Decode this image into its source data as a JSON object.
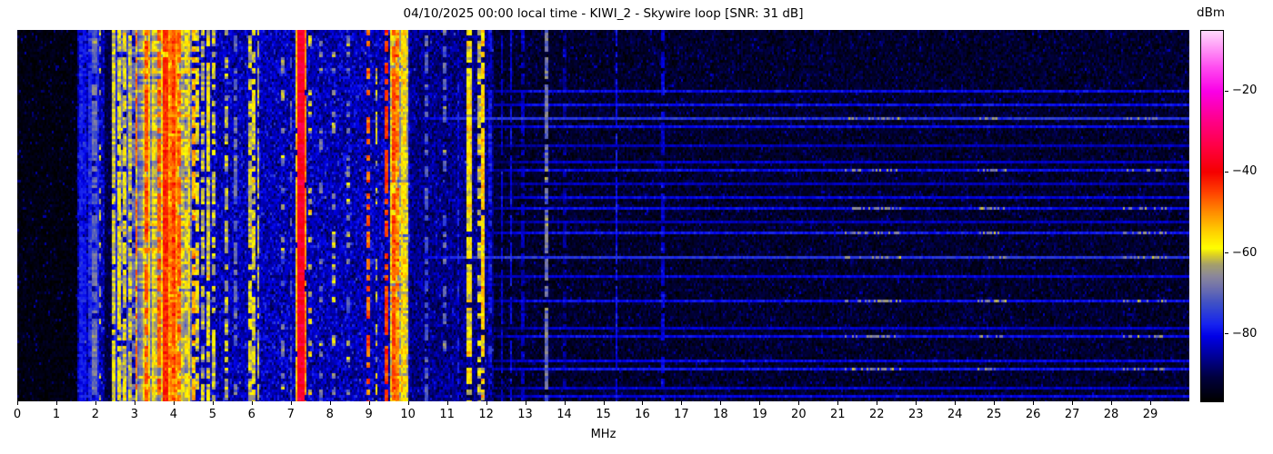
{
  "header": {
    "title": "04/10/2025 00:00 local time - KIWI_2 - Skywire loop [SNR: 31 dB]"
  },
  "chart_data": {
    "type": "heatmap",
    "subtype": "radio-spectrum-waterfall",
    "title": "04/10/2025 00:00 local time - KIWI_2 - Skywire loop [SNR: 31 dB]",
    "xlabel": "MHz",
    "x_range_mhz": [
      0,
      30
    ],
    "x_ticks": [
      "0",
      "1",
      "2",
      "3",
      "4",
      "5",
      "6",
      "7",
      "8",
      "9",
      "10",
      "11",
      "12",
      "13",
      "14",
      "15",
      "16",
      "17",
      "18",
      "19",
      "20",
      "21",
      "22",
      "23",
      "24",
      "25",
      "26",
      "27",
      "28",
      "29"
    ],
    "colorbar": {
      "label": "dBm",
      "tick_labels": [
        "−20",
        "−40",
        "−60",
        "−80"
      ],
      "tick_values": [
        -20,
        -40,
        -60,
        -80
      ],
      "range_dbm": [
        -97,
        -5
      ]
    },
    "colormap_stops": [
      [
        -97,
        "#000000"
      ],
      [
        -91,
        "#000040"
      ],
      [
        -86,
        "#000096"
      ],
      [
        -81,
        "#0000e6"
      ],
      [
        -78,
        "#1622f0"
      ],
      [
        -73,
        "#3c4ec8"
      ],
      [
        -69,
        "#6d6fae"
      ],
      [
        -66,
        "#8b879b"
      ],
      [
        -63,
        "#a6a06a"
      ],
      [
        -60.5,
        "#e0d520"
      ],
      [
        -59,
        "#ffff00"
      ],
      [
        -55,
        "#ffd200"
      ],
      [
        -50,
        "#ff8c00"
      ],
      [
        -45,
        "#ff4000"
      ],
      [
        -40,
        "#f50000"
      ],
      [
        -34,
        "#ff0040"
      ],
      [
        -27,
        "#ff008c"
      ],
      [
        -20,
        "#fa00e6"
      ],
      [
        -14,
        "#ff4cf0"
      ],
      [
        -8,
        "#ffaaf8"
      ],
      [
        -5,
        "#ffd8fc"
      ]
    ],
    "noise_regions": [
      {
        "f1": 0,
        "f2": 1.55,
        "base": -95.5,
        "sigma": 1.3,
        "speckle": 0.05,
        "spv": 7
      },
      {
        "f1": 2.24,
        "f2": 2.42,
        "base": -91,
        "sigma": 2.0,
        "speckle": 0.05,
        "spv": 6
      },
      {
        "f1": 1.55,
        "f2": 10.05,
        "base": -84,
        "sigma": 3.5,
        "speckle": 0.03,
        "spv": 6
      },
      {
        "f1": 10.05,
        "f2": 12.2,
        "base": -87,
        "sigma": 3.0,
        "speckle": 0.03,
        "spv": 6
      },
      {
        "f1": 12.2,
        "f2": 30,
        "base": -93,
        "sigma": 2.2,
        "speckle": 0.06,
        "spv": 5
      }
    ],
    "signal_bands": [
      {
        "f": 1.62,
        "w": 0.06,
        "v": -79,
        "j": 3,
        "duty": 0.95
      },
      {
        "f": 1.74,
        "w": 0.05,
        "v": -80,
        "j": 3,
        "duty": 0.9
      },
      {
        "f": 1.87,
        "w": 0.06,
        "v": -77,
        "j": 4,
        "duty": 0.95
      },
      {
        "f": 1.98,
        "w": 0.05,
        "v": -70,
        "j": 5,
        "duty": 0.8
      },
      {
        "f": 2.06,
        "w": 0.04,
        "v": -78,
        "j": 3,
        "duty": 0.9
      },
      {
        "f": 2.11,
        "w": 0.03,
        "v": -62,
        "j": 3,
        "duty": 0.25
      },
      {
        "f": 2.46,
        "w": 0.05,
        "v": -61,
        "j": 4,
        "duty": 0.9
      },
      {
        "f": 2.52,
        "w": 0.03,
        "v": -78,
        "j": 3,
        "duty": 1
      },
      {
        "f": 2.59,
        "w": 0.05,
        "v": -60,
        "j": 4,
        "duty": 0.9
      },
      {
        "f": 2.67,
        "w": 0.04,
        "v": -68,
        "j": 6,
        "duty": 0.8
      },
      {
        "f": 2.74,
        "w": 0.05,
        "v": -60,
        "j": 5,
        "duty": 0.85
      },
      {
        "f": 2.83,
        "w": 0.04,
        "v": -75,
        "j": 4,
        "duty": 0.9
      },
      {
        "f": 2.9,
        "w": 0.05,
        "v": -62,
        "j": 5,
        "duty": 0.85
      },
      {
        "f": 2.97,
        "w": 0.04,
        "v": -70,
        "j": 5,
        "duty": 0.7
      },
      {
        "f1": 3.05,
        "f2": 4.45,
        "v": -63,
        "j": 6
      },
      {
        "f1": 3.7,
        "f2": 4.12,
        "v": -55,
        "j": 5
      },
      {
        "f": 3.05,
        "w": 0.035,
        "v": -48,
        "j": 4,
        "duty": 0.7
      },
      {
        "f": 3.3,
        "w": 0.04,
        "v": -46,
        "j": 4,
        "duty": 0.8
      },
      {
        "f": 3.62,
        "w": 0.04,
        "v": -47,
        "j": 4,
        "duty": 0.75
      },
      {
        "f": 3.79,
        "w": 0.06,
        "v": -43,
        "j": 3,
        "duty": 0.95
      },
      {
        "f": 3.9,
        "w": 0.05,
        "v": -50,
        "j": 4,
        "duty": 0.8
      },
      {
        "f": 4.0,
        "w": 0.05,
        "v": -45,
        "j": 4,
        "duty": 0.85
      },
      {
        "f": 4.16,
        "w": 0.04,
        "v": -47,
        "j": 4,
        "duty": 0.8
      },
      {
        "f": 4.33,
        "w": 0.04,
        "v": -60,
        "j": 5,
        "duty": 0.8
      },
      {
        "f": 4.5,
        "w": 0.04,
        "v": -52,
        "j": 5,
        "duty": 0.6
      },
      {
        "f": 4.62,
        "w": 0.05,
        "v": -60,
        "j": 5,
        "duty": 0.8
      },
      {
        "f": 4.75,
        "w": 0.04,
        "v": -63,
        "j": 5,
        "duty": 0.7
      },
      {
        "f": 4.9,
        "w": 0.05,
        "v": -60,
        "j": 5,
        "duty": 0.8
      },
      {
        "f": 5.02,
        "w": 0.04,
        "v": -62,
        "j": 5,
        "duty": 0.7
      },
      {
        "f": 5.35,
        "w": 0.04,
        "v": -63,
        "j": 5,
        "duty": 0.6
      },
      {
        "f": 5.6,
        "w": 0.03,
        "v": -70,
        "j": 5,
        "duty": 0.5
      },
      {
        "f": 5.95,
        "w": 0.05,
        "v": -61,
        "j": 5,
        "duty": 0.8
      },
      {
        "f": 6.07,
        "w": 0.05,
        "v": -60,
        "j": 5,
        "duty": 0.85
      },
      {
        "f": 6.17,
        "w": 0.04,
        "v": -63,
        "j": 5,
        "duty": 0.7
      },
      {
        "f": 6.8,
        "w": 0.03,
        "v": -66,
        "j": 6,
        "duty": 0.35
      },
      {
        "f": 7.0,
        "w": 0.03,
        "v": -72,
        "j": 5,
        "duty": 0.4
      },
      {
        "f": 7.17,
        "w": 0.04,
        "v": -55,
        "j": 4,
        "duty": 0.9
      },
      {
        "f": 7.25,
        "w": 0.12,
        "v": -36,
        "j": 3,
        "duty": 1
      },
      {
        "f": 7.33,
        "w": 0.05,
        "v": -50,
        "j": 4,
        "duty": 0.9
      },
      {
        "f": 7.5,
        "w": 0.03,
        "v": -60,
        "j": 8,
        "duty": 0.2
      },
      {
        "f": 7.78,
        "w": 0.03,
        "v": -67,
        "j": 6,
        "duty": 0.3
      },
      {
        "f": 8.1,
        "w": 0.03,
        "v": -64,
        "j": 6,
        "duty": 0.3
      },
      {
        "f": 8.47,
        "w": 0.03,
        "v": -68,
        "j": 6,
        "duty": 0.3
      },
      {
        "f": 9.0,
        "w": 0.035,
        "v": -47,
        "j": 5,
        "duty": 0.45
      },
      {
        "f": 9.2,
        "w": 0.03,
        "v": -60,
        "j": 6,
        "duty": 0.4
      },
      {
        "f": 9.43,
        "w": 0.045,
        "v": -44,
        "j": 4,
        "duty": 0.65
      },
      {
        "f": 9.62,
        "w": 0.05,
        "v": -46,
        "j": 4,
        "duty": 0.9
      },
      {
        "f1": 9.55,
        "f2": 10.0,
        "v": -60,
        "j": 6
      },
      {
        "f": 9.75,
        "w": 0.05,
        "v": -50,
        "j": 5,
        "duty": 0.8
      },
      {
        "f": 9.9,
        "w": 0.04,
        "v": -58,
        "j": 5,
        "duty": 0.8
      },
      {
        "f": 10.47,
        "w": 0.03,
        "v": -72,
        "j": 4,
        "duty": 0.5
      },
      {
        "f": 10.93,
        "w": 0.03,
        "v": -70,
        "j": 5,
        "duty": 0.4
      },
      {
        "f": 11.28,
        "w": 0.03,
        "v": -80,
        "j": 4,
        "duty": 0.6
      },
      {
        "f": 11.56,
        "w": 0.07,
        "v": -58,
        "j": 5,
        "duty": 0.95
      },
      {
        "f": 11.82,
        "w": 0.03,
        "v": -62,
        "j": 6,
        "duty": 0.5
      },
      {
        "f": 11.93,
        "w": 0.045,
        "v": -55,
        "j": 5,
        "duty": 0.9
      },
      {
        "f": 12.1,
        "w": 0.03,
        "v": -80,
        "j": 4,
        "duty": 0.7
      },
      {
        "f": 12.4,
        "w": 0.03,
        "v": -83,
        "j": 3,
        "duty": 0.8
      },
      {
        "f": 12.63,
        "w": 0.03,
        "v": -81,
        "j": 3,
        "duty": 0.8
      },
      {
        "f": 12.95,
        "w": 0.03,
        "v": -84,
        "j": 3,
        "duty": 0.7
      },
      {
        "f": 13.55,
        "w": 0.035,
        "v": -69,
        "j": 5,
        "duty": 0.85
      },
      {
        "f": 14.0,
        "w": 0.025,
        "v": -86,
        "j": 3,
        "duty": 0.5
      },
      {
        "f": 15.33,
        "w": 0.03,
        "v": -80,
        "j": 3,
        "duty": 0.85
      },
      {
        "f": 16.53,
        "w": 0.03,
        "v": -82,
        "j": 3,
        "duty": 0.7
      }
    ],
    "time_streaks": [
      {
        "y": 0.164,
        "v": -80,
        "hot": false,
        "fmin": 12.2
      },
      {
        "y": 0.196,
        "v": -80,
        "hot": false,
        "fmin": 12.2
      },
      {
        "y": 0.23,
        "v": -76,
        "hot": true,
        "fmin": 10.4
      },
      {
        "y": 0.257,
        "v": -80,
        "hot": false,
        "fmin": 12.2
      },
      {
        "y": 0.306,
        "v": -84,
        "hot": false,
        "fmin": 12.2
      },
      {
        "y": 0.352,
        "v": -83,
        "hot": false,
        "fmin": 12.2
      },
      {
        "y": 0.372,
        "v": -80,
        "hot": true,
        "fmin": 12.2
      },
      {
        "y": 0.408,
        "v": -84,
        "hot": false,
        "fmin": 12.2
      },
      {
        "y": 0.445,
        "v": -81,
        "hot": false,
        "fmin": 12.2
      },
      {
        "y": 0.474,
        "v": -80,
        "hot": true,
        "fmin": 12.2
      },
      {
        "y": 0.513,
        "v": -84,
        "hot": false,
        "fmin": 12.2
      },
      {
        "y": 0.538,
        "v": -79,
        "hot": true,
        "fmin": 12.2
      },
      {
        "y": 0.604,
        "v": -76,
        "hot": true,
        "fmin": 10.4
      },
      {
        "y": 0.658,
        "v": -81,
        "hot": false,
        "fmin": 12.2
      },
      {
        "y": 0.721,
        "v": -80,
        "hot": true,
        "fmin": 12.2
      },
      {
        "y": 0.795,
        "v": -83,
        "hot": false,
        "fmin": 12.2
      },
      {
        "y": 0.819,
        "v": -80,
        "hot": true,
        "fmin": 12.2
      },
      {
        "y": 0.88,
        "v": -81,
        "hot": false,
        "fmin": 12.2
      },
      {
        "y": 0.905,
        "v": -79,
        "hot": true,
        "fmin": 12.2
      },
      {
        "y": 0.958,
        "v": -83,
        "hot": false,
        "fmin": 12.2
      },
      {
        "y": 0.978,
        "v": -81,
        "hot": false,
        "fmin": 12.2
      }
    ],
    "hot_segments_mhz": [
      [
        21.2,
        22.6
      ],
      [
        24.6,
        25.3
      ],
      [
        28.3,
        29.4
      ]
    ],
    "render_seed": 20250410
  }
}
